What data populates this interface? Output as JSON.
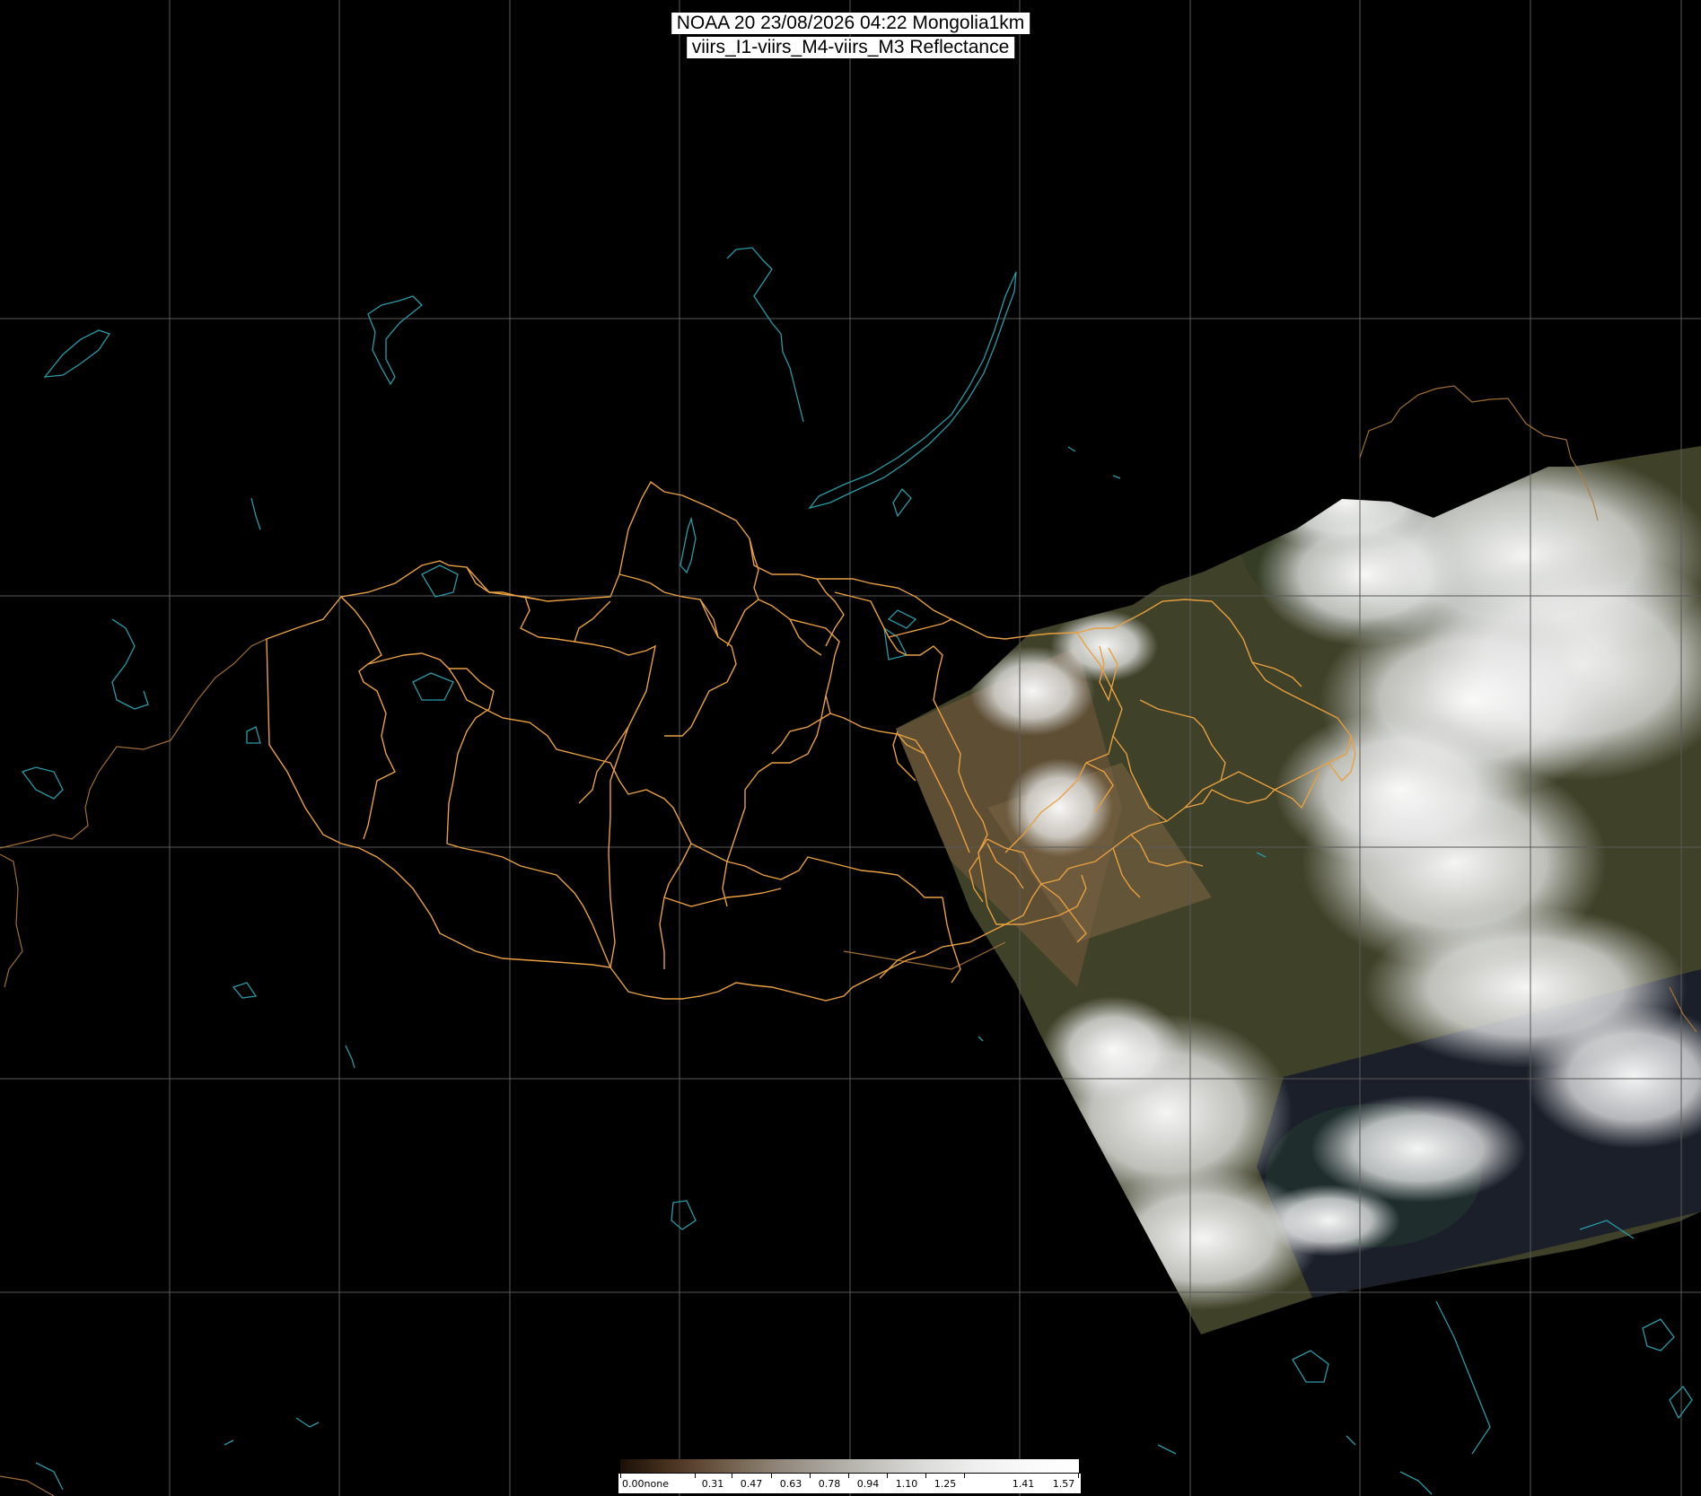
{
  "title": {
    "line1": "NOAA 20 23/08/2026 04:22 Mongolia1km",
    "line2": "viirs_I1-viirs_M4-viirs_M3 Reflectance"
  },
  "colors": {
    "background": "#000000",
    "grid": "#5a5a5a",
    "admin_border": "#e8a040",
    "country_border": "#b07a3a",
    "water": "#2a9aa6",
    "cloud": "#f2f2f2",
    "land": "#4b4a2c"
  },
  "colorbar": {
    "labels": [
      "0.00none",
      "0.31",
      "0.47",
      "0.63",
      "0.78",
      "0.94",
      "1.10",
      "1.25",
      "1.41",
      "1.57"
    ]
  }
}
